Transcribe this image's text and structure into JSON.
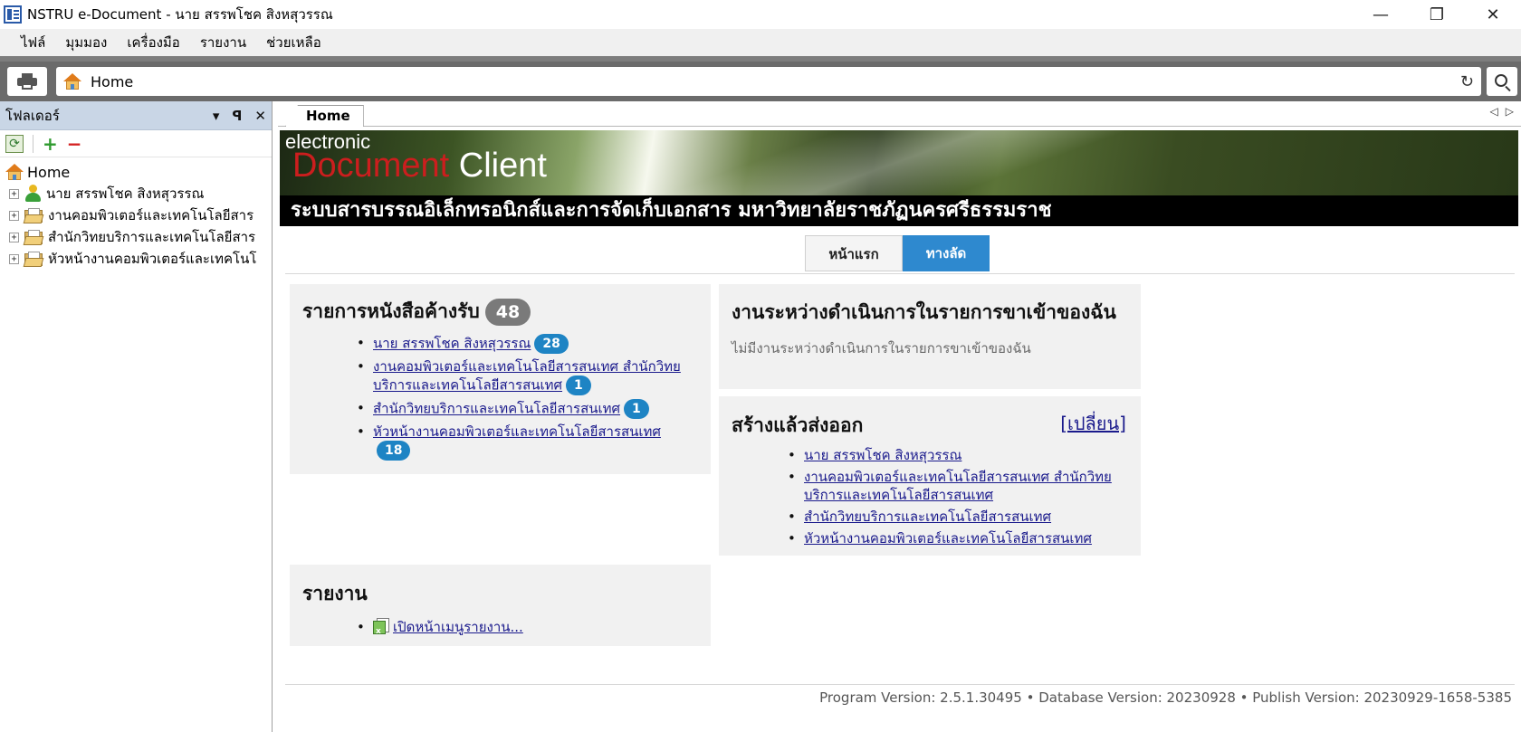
{
  "window": {
    "title": "NSTRU e-Document - นาย สรรพโชค สิงหสุวรรณ",
    "minimize": "—",
    "restore": "❐",
    "close": "✕"
  },
  "menu": [
    "ไฟล์",
    "มุมมอง",
    "เครื่องมือ",
    "รายงาน",
    "ช่วยเหลือ"
  ],
  "address": {
    "text": "Home",
    "refresh": "↻"
  },
  "left_panel": {
    "title": "โฟลเดอร์",
    "ctrl_dropdown": "▾",
    "ctrl_pin": "ꟼ",
    "ctrl_close": "✕",
    "tool_refresh": "⟳",
    "tool_add": "+",
    "tool_remove": "−",
    "tree": {
      "root": "Home",
      "items": [
        {
          "icon": "user-icon",
          "label": "นาย สรรพโชค สิงหสุวรรณ"
        },
        {
          "icon": "folder-icon",
          "label": "งานคอมพิวเตอร์และเทคโนโลยีสาร"
        },
        {
          "icon": "folder-icon",
          "label": "สำนักวิทยบริการและเทคโนโลยีสาร"
        },
        {
          "icon": "folder-icon",
          "label": "หัวหน้างานคอมพิวเตอร์และเทคโนโ"
        }
      ]
    }
  },
  "tab": {
    "label": "Home",
    "prev": "◁",
    "next": "▷"
  },
  "banner": {
    "small": "electronic",
    "big_red": "Document",
    "big_white": " Client",
    "heading": "ระบบสารบรรณอิเล็กทรอนิกส์และการจัดเก็บเอกสาร มหาวิทยาลัยราชภัฏนครศรีธรรมราช"
  },
  "switcher": {
    "first": "หน้าแรก",
    "shortcut": "ทางลัด"
  },
  "pending": {
    "title": "รายการหนังสือค้างรับ",
    "count": "48",
    "items": [
      {
        "label": "นาย สรรพโชค สิงหสุวรรณ",
        "count": "28"
      },
      {
        "label": "งานคอมพิวเตอร์และเทคโนโลยีสารสนเทศ สำนักวิทยบริการและเทคโนโลยีสารสนเทศ",
        "count": "1"
      },
      {
        "label": "สำนักวิทยบริการและเทคโนโลยีสารสนเทศ",
        "count": "1"
      },
      {
        "label": "หัวหน้างานคอมพิวเตอร์และเทคโนโลยีสารสนเทศ",
        "count": "18"
      }
    ]
  },
  "inprogress": {
    "title": "งานระหว่างดำเนินการในรายการขาเข้าของฉัน",
    "empty": "ไม่มีงานระหว่างดำเนินการในรายการขาเข้าของฉัน"
  },
  "outgoing": {
    "title": "สร้างแล้วส่งออก",
    "change": "[เปลี่ยน]",
    "items": [
      "นาย สรรพโชค สิงหสุวรรณ",
      "งานคอมพิวเตอร์และเทคโนโลยีสารสนเทศ สำนักวิทยบริการและเทคโนโลยีสารสนเทศ",
      "สำนักวิทยบริการและเทคโนโลยีสารสนเทศ",
      "หัวหน้างานคอมพิวเตอร์และเทคโนโลยีสารสนเทศ"
    ]
  },
  "reports": {
    "title": "รายงาน",
    "link": "เปิดหน้าเมนูรายงาน..."
  },
  "footer": "Program Version: 2.5.1.30495 • Database Version: 20230928 • Publish Version: 20230929-1658-5385",
  "colors": {
    "accent": "#2e89cf",
    "badge": "#1e84c4",
    "panel_header": "#c9d6e6",
    "link": "#1a1a8c"
  }
}
